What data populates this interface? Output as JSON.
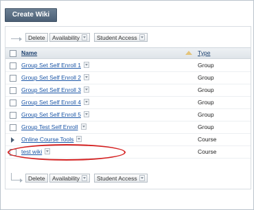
{
  "toolbar": {
    "create_label": "Create Wiki"
  },
  "action_bar": {
    "delete_label": "Delete",
    "availability_label": "Availability",
    "student_access_label": "Student Access"
  },
  "table": {
    "columns": {
      "name": "Name",
      "type": "Type"
    },
    "rows": [
      {
        "name": "Group Set Self Enroll 1",
        "type": "Group"
      },
      {
        "name": "Group Set Self Enroll 2",
        "type": "Group"
      },
      {
        "name": "Group Set Self Enroll 3",
        "type": "Group"
      },
      {
        "name": "Group Set Self Enroll 4",
        "type": "Group"
      },
      {
        "name": "Group Set Self Enroll 5",
        "type": "Group"
      },
      {
        "name": "Group Test Self Enroll",
        "type": "Group"
      },
      {
        "name": "Online Course Tools",
        "type": "Course"
      },
      {
        "name": "test wiki",
        "type": "Course"
      }
    ]
  },
  "colors": {
    "header_button": "#4c6076",
    "link": "#1a55a6",
    "highlight": "#d42020"
  },
  "icons": {
    "sort": "sort-ascending-icon",
    "menu": "chevron-down-icon",
    "arrow": "arrow-icon"
  }
}
